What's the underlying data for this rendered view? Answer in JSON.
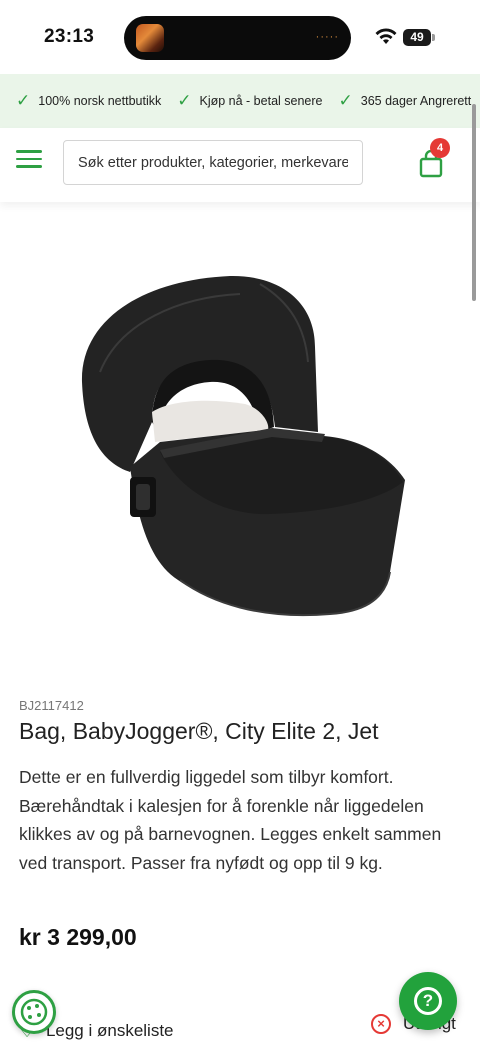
{
  "status_bar": {
    "time": "23:13",
    "battery": "49",
    "battery_level": 0.49
  },
  "usp": {
    "items": [
      {
        "icon": "check-icon",
        "label": "100% norsk nettbutikk"
      },
      {
        "icon": "check-icon",
        "label": "Kjøp nå - betal senere"
      },
      {
        "icon": "check-icon",
        "label": "365 dager Angrerett"
      }
    ]
  },
  "header": {
    "search_placeholder": "Søk etter produkter, kategorier, merkevarer",
    "cart_count": "4"
  },
  "product": {
    "sku": "BJ2117412",
    "title": "Bag, BabyJogger®, City Elite 2, Jet",
    "description": "Dette er en fullverdig liggedel som tilbyr komfort. Bærehåndtak i kalesjen for å forenkle når liggedelen klikkes av og på barnevognen. Legges enkelt sammen ved transport. Passer fra nyfødt og opp til 9 kg.",
    "price": "kr 3 299,00"
  },
  "actions": {
    "wishlist_label": "Legg i ønskeliste",
    "soldout_label": "Utsolgt"
  },
  "colors": {
    "brand_green": "#2ea043",
    "usp_background": "#eaf5e9",
    "badge_red": "#e53935"
  }
}
